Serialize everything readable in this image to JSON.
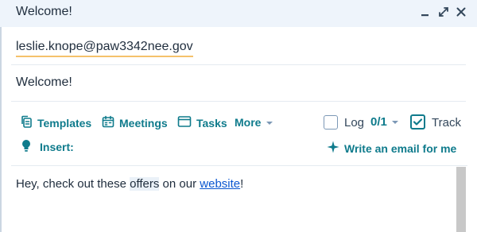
{
  "window": {
    "title": "Welcome!",
    "controls": [
      "minimize-icon",
      "expand-icon",
      "close-icon"
    ]
  },
  "email": {
    "to": "leslie.knope@paw3342nee.gov",
    "subject": "Welcome!"
  },
  "toolbar": {
    "templates_label": "Templates",
    "meetings_label": "Meetings",
    "tasks_label": "Tasks",
    "more_label": "More",
    "log_label": "Log",
    "log_count": "0/1",
    "log_checked": false,
    "track_label": "Track",
    "track_checked": true,
    "insert_label": "Insert:",
    "ai_label": "Write an email for me"
  },
  "body": {
    "text_before": "Hey, check out these ",
    "highlight": "offers",
    "text_middle": " on our ",
    "link": "website",
    "text_after": "!"
  },
  "colors": {
    "accent": "#0f7b8c",
    "titlebar_bg": "#eef4fb",
    "text": "#33475b",
    "link": "#0b57d0"
  }
}
